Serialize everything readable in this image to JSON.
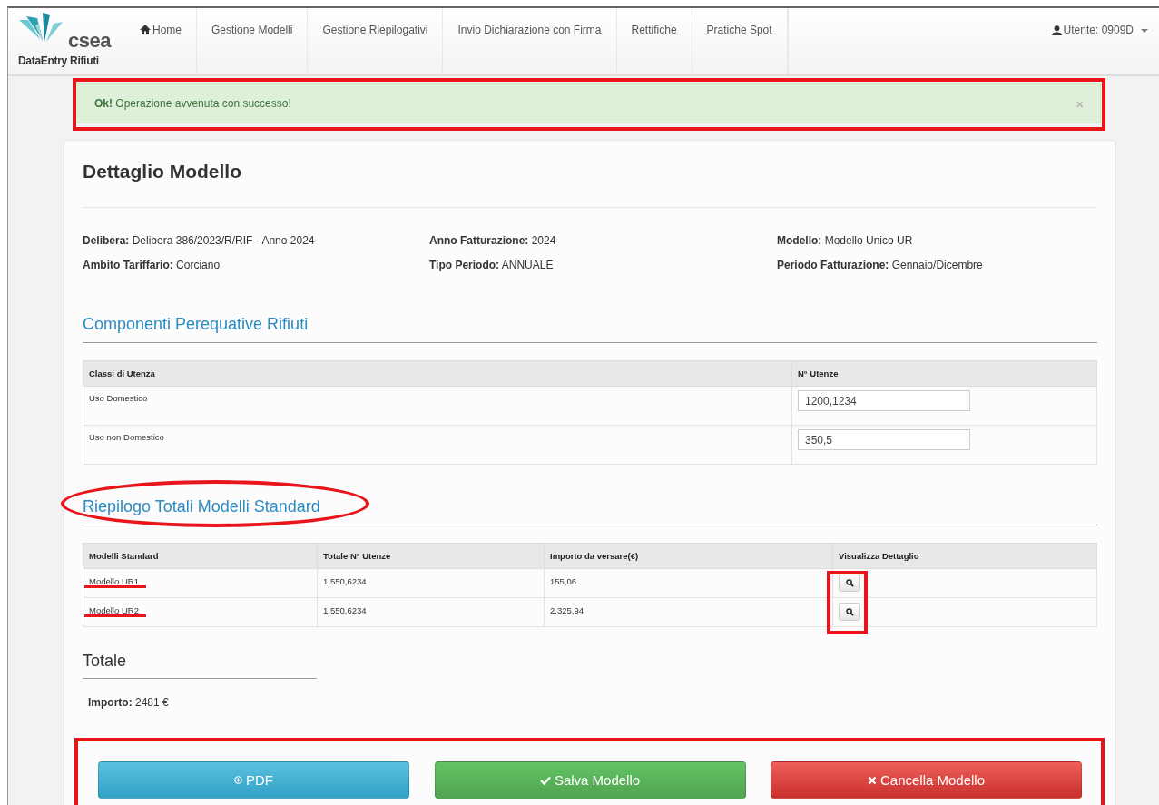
{
  "navbar": {
    "logo": {
      "name": "csea",
      "subtitle": "DataEntry Rifiuti"
    },
    "items": [
      {
        "label": "Home",
        "kind": "home",
        "selected": false
      },
      {
        "label": "Gestione Modelli",
        "kind": "link",
        "selected": false
      },
      {
        "label": "Gestione Riepilogativi",
        "kind": "link",
        "selected": false
      },
      {
        "label": "Invio Dichiarazione con Firma",
        "kind": "link",
        "selected": false
      },
      {
        "label": "Rettifiche",
        "kind": "link",
        "selected": false
      },
      {
        "label": "Pratiche Spot",
        "kind": "link",
        "selected": false
      }
    ],
    "user": "Utente: 0909D"
  },
  "alert": {
    "strong": "Ok!",
    "message": "Operazione avvenuta con successo!",
    "close": "×"
  },
  "title": "Dettaglio Modello",
  "info": [
    {
      "label": "Delibera:",
      "value": "Delibera 386/2023/R/RIF - Anno 2024"
    },
    {
      "label": "Anno Fatturazione:",
      "value": "2024"
    },
    {
      "label": "Modello:",
      "value": "Modello Unico UR"
    },
    {
      "label": "Ambito Tariffario:",
      "value": "Corciano"
    },
    {
      "label": "Tipo Periodo:",
      "value": "ANNUALE"
    },
    {
      "label": "Periodo Fatturazione:",
      "value": "Gennaio/Dicembre"
    }
  ],
  "components": {
    "heading": "Componenti Perequative Rifiuti",
    "columns": [
      "Classi di Utenza",
      "N° Utenze"
    ],
    "rows": [
      {
        "label": "Uso Domestico",
        "value": "1200,1234"
      },
      {
        "label": "Uso non Domestico",
        "value": "350,5"
      }
    ]
  },
  "summary": {
    "heading": "Riepilogo Totali Modelli Standard",
    "columns": [
      "Modelli Standard",
      "Totale N° Utenze",
      "Importo da versare(€)",
      "Visualizza Dettaglio"
    ],
    "rows": [
      {
        "model": "Modello UR1",
        "total": "1.550,6234",
        "amount": "155,06"
      },
      {
        "model": "Modello UR2",
        "total": "1.550,6234",
        "amount": "2.325,94"
      }
    ]
  },
  "total": {
    "heading": "Totale",
    "label": "Importo:",
    "value": "2481 €"
  },
  "buttons": [
    {
      "label": "PDF",
      "kind": "pdf"
    },
    {
      "label": "Salva Modello",
      "kind": "save"
    },
    {
      "label": "Cancella Modello",
      "kind": "delete"
    }
  ]
}
